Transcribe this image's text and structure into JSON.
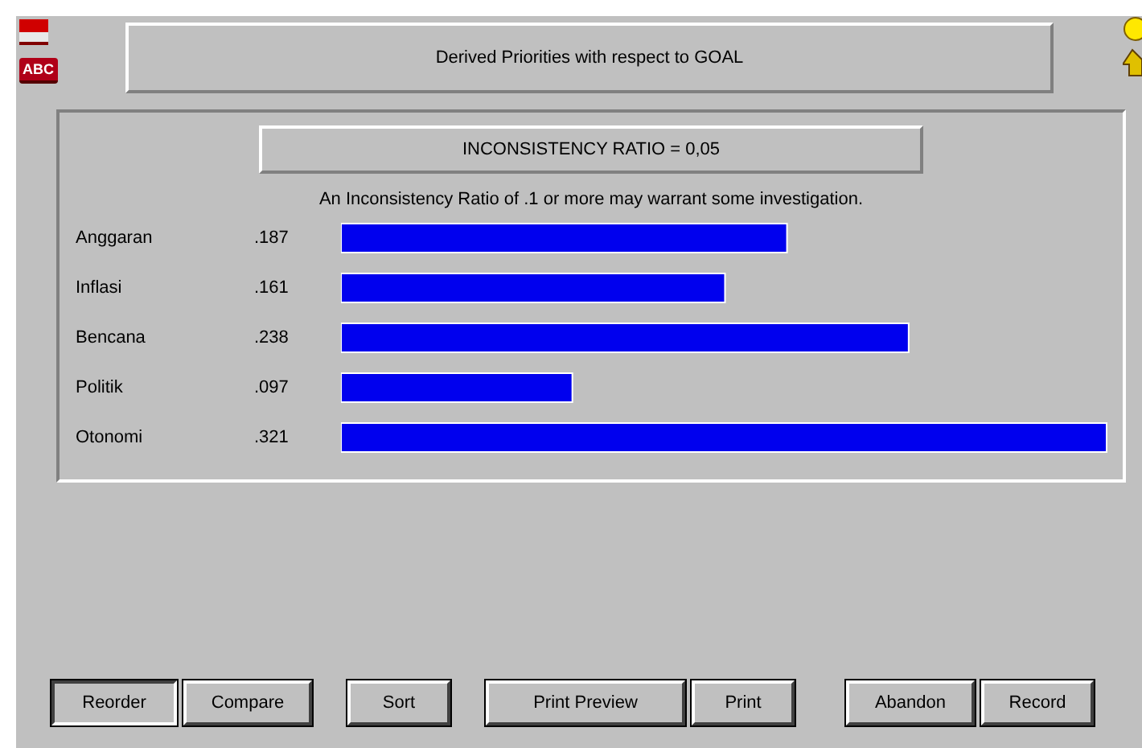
{
  "toolbar": {
    "icons": [
      {
        "kind": "flag"
      },
      {
        "kind": "abc",
        "label": "ABC"
      }
    ]
  },
  "header": {
    "title": "Derived Priorities with respect to GOAL"
  },
  "side_icons": [
    {
      "kind": "bulb"
    },
    {
      "kind": "people"
    }
  ],
  "panel": {
    "ratio": "INCONSISTENCY RATIO = 0,05",
    "note": "An Inconsistency Ratio of .1 or more may warrant some investigation.",
    "chart_data": {
      "type": "bar",
      "orientation": "horizontal",
      "categories": [
        "Anggaran",
        "Inflasi",
        "Bencana",
        "Politik",
        "Otonomi"
      ],
      "values": [
        0.187,
        0.161,
        0.238,
        0.097,
        0.321
      ],
      "value_labels": [
        ".187",
        ".161",
        ".238",
        ".097",
        ".321"
      ]
    }
  },
  "buttons": [
    {
      "label": "Reorder",
      "pressed": true
    },
    {
      "label": "Compare",
      "pressed": false
    },
    {
      "label": "Sort",
      "pressed": false
    },
    {
      "label": "Print Preview",
      "pressed": false
    },
    {
      "label": "Print",
      "pressed": false
    },
    {
      "label": "Abandon",
      "pressed": false
    },
    {
      "label": "Record",
      "pressed": false
    }
  ]
}
